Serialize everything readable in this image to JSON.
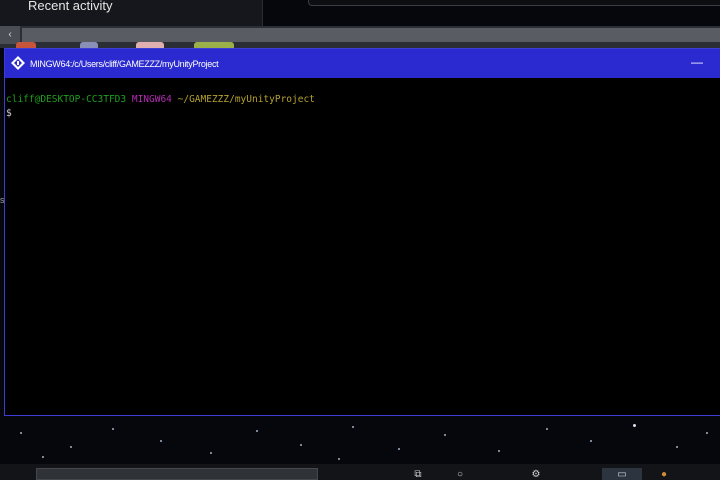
{
  "background_app": {
    "section_title": "Recent activity",
    "scroll_left_icon": "chevron-left-icon"
  },
  "terminal": {
    "title": "MINGW64:/c/Users/cliff/GAMEZZZ/myUnityProject",
    "app_icon": "git-bash-diamond-icon",
    "minimize_glyph": "—",
    "prompt": {
      "user_host": "cliff@DESKTOP-CC3TFD3",
      "env": "MINGW64",
      "path": "~/GAMEZZZ/myUnityProject",
      "symbol": "$"
    },
    "colors": {
      "titlebar": "#2a2ad0",
      "user_host": "#1ea01e",
      "env": "#b32cb3",
      "path": "#b5a12e",
      "background": "#000000"
    }
  },
  "taskbar": {
    "icons": [
      "task-view-icon",
      "search-icon",
      "settings-icon",
      "terminal-taskbar-icon",
      "app-icon"
    ]
  }
}
